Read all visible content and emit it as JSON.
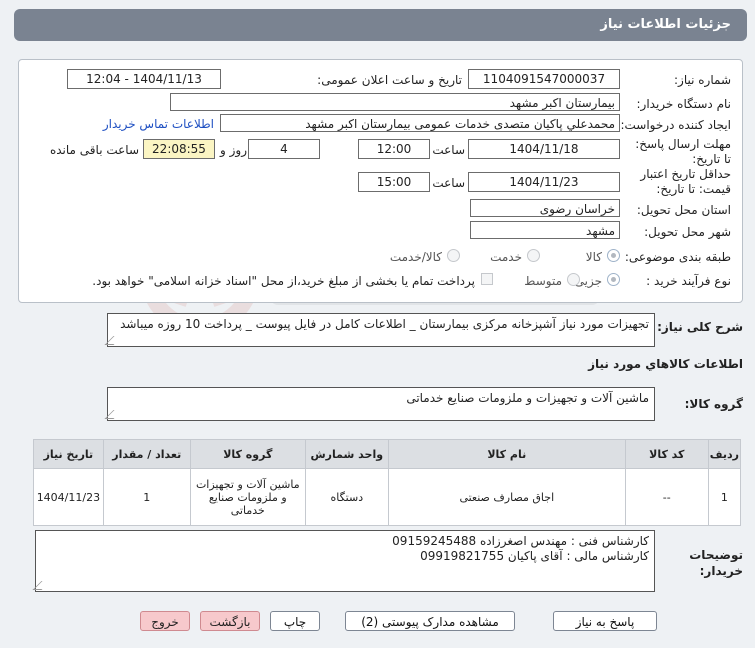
{
  "header": {
    "title": "جزئیات اطلاعات نیاز"
  },
  "form": {
    "need_number_label": "شماره نیاز:",
    "need_number": "1104091547000037",
    "announce_label": "تاریخ و ساعت اعلان عمومی:",
    "announce_value": "1404/11/13 - 12:04",
    "buyer_org_label": "نام دستگاه خریدار:",
    "buyer_org": "بیمارستان اکبر مشهد",
    "creator_label": "ایجاد کننده درخواست:",
    "creator": "محمدعلي پاكيان متصدی خدمات عمومی بيمارستان اكبر مشهد",
    "contact_link": "اطلاعات تماس خریدار",
    "deadline_label": "مهلت ارسال پاسخ: تا تاریخ:",
    "deadline_date": "1404/11/18",
    "time_label": "ساعت",
    "deadline_time": "12:00",
    "days_value": "4",
    "days_label": "روز و",
    "remaining_time": "22:08:55",
    "remaining_label": "ساعت باقی مانده",
    "validity_label": "حداقل تاریخ اعتبار قیمت: تا تاریخ:",
    "validity_date": "1404/11/23",
    "validity_time": "15:00",
    "province_label": "استان محل تحویل:",
    "province": "خراسان رضوی",
    "city_label": "شهر محل تحویل:",
    "city": "مشهد",
    "category_label": "طبقه بندی موضوعی:",
    "category_options": [
      "کالا",
      "خدمت",
      "کالا/خدمت"
    ],
    "purchase_type_label": "نوع فرآیند خرید :",
    "purchase_options": [
      "جزیی",
      "متوسط"
    ],
    "treasury_text": "پرداخت تمام یا بخشی از مبلغ خرید،از محل \"اسناد خزانه اسلامی\" خواهد بود."
  },
  "summary": {
    "label": "شرح کلی نیاز:",
    "text": "تجهیزات مورد نیاز آشپزخانه مرکزی بیمارستان _ اطلاعات کامل در فایل پیوست _ پرداخت 10 روزه میباشد"
  },
  "goods_info_title": "اطلاعات كالاهاي مورد نياز",
  "goods_group": {
    "label": "گروه کالا:",
    "value": "ماشین آلات و تجهیزات و ملزومات صنایع خدماتی"
  },
  "table": {
    "headers": [
      "ردیف",
      "کد کالا",
      "نام کالا",
      "واحد شمارش",
      "گروه کالا",
      "تعداد / مقدار",
      "تاریخ نیاز"
    ],
    "rows": [
      [
        "1",
        "--",
        "اجاق مصارف صنعتی",
        "دستگاه",
        "ماشین آلات و تجهیزات و ملزومات صنایع خدماتی",
        "1",
        "1404/11/23"
      ]
    ]
  },
  "buyer_notes": {
    "label": "توضیحات خریدار:",
    "line1": "کارشناس فنی : مهندس اصغرزاده 09159245488",
    "line2": "کارشناس مالی : آقای پاکیان 09919821755"
  },
  "buttons": {
    "reply": "پاسخ به نیاز",
    "docs": "مشاهده مدارک پیوستی (2)",
    "print": "چاپ",
    "back": "بازگشت",
    "exit": "خروج"
  }
}
